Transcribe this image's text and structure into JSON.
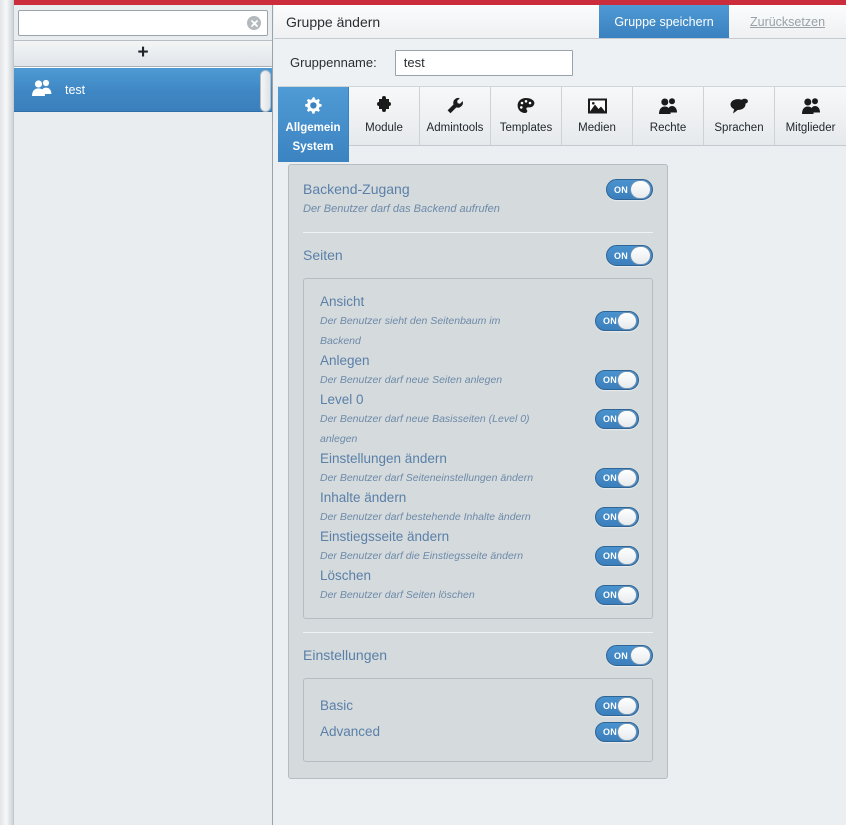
{
  "theme": {
    "accent": "#3c83c1",
    "red_bar": "#cc2d3c",
    "panel_bg": "#d5dadd",
    "title_color": "#5a80a8"
  },
  "sidebar": {
    "search": {
      "value": "",
      "placeholder": "",
      "clear_icon": "clear-circle-icon"
    },
    "add_button": {
      "label": "+",
      "icon": "plus-icon"
    },
    "items": [
      {
        "label": "test",
        "icon": "users-icon",
        "selected": true
      }
    ]
  },
  "header": {
    "title": "Gruppe ändern",
    "save_label": "Gruppe speichern",
    "reset_label": "Zurücksetzen"
  },
  "form": {
    "group_name_label": "Gruppenname:",
    "group_name_value": "test",
    "group_name_placeholder": ""
  },
  "tabs": [
    {
      "label": "Allgemein",
      "sublabel": "System",
      "icon": "gear-icon",
      "active": true
    },
    {
      "label": "Module",
      "sublabel": "",
      "icon": "puzzle-icon",
      "active": false
    },
    {
      "label": "Admintools",
      "sublabel": "",
      "icon": "wrench-icon",
      "active": false
    },
    {
      "label": "Templates",
      "sublabel": "",
      "icon": "palette-icon",
      "active": false
    },
    {
      "label": "Medien",
      "sublabel": "",
      "icon": "image-icon",
      "active": false
    },
    {
      "label": "Rechte",
      "sublabel": "",
      "icon": "user-icon",
      "active": false
    },
    {
      "label": "Sprachen",
      "sublabel": "",
      "icon": "speech-bubble-icon",
      "active": false
    },
    {
      "label": "Mitglieder",
      "sublabel": "",
      "icon": "user-icon",
      "active": false
    }
  ],
  "settings": {
    "backend_access": {
      "title": "Backend-Zugang",
      "desc": "Der Benutzer darf das Backend aufrufen",
      "toggle": "ON"
    },
    "pages": {
      "title": "Seiten",
      "toggle": "ON",
      "items": [
        {
          "title": "Ansicht",
          "desc": "Der Benutzer sieht den Seitenbaum im Backend",
          "toggle": "ON"
        },
        {
          "title": "Anlegen",
          "desc": "Der Benutzer darf neue Seiten anlegen",
          "toggle": "ON"
        },
        {
          "title": "Level 0",
          "desc": "Der Benutzer darf neue Basisseiten (Level 0) anlegen",
          "toggle": "ON"
        },
        {
          "title": "Einstellungen ändern",
          "desc": "Der Benutzer darf Seiteneinstellungen ändern",
          "toggle": "ON"
        },
        {
          "title": "Inhalte ändern",
          "desc": "Der Benutzer darf bestehende Inhalte ändern",
          "toggle": "ON"
        },
        {
          "title": "Einstiegsseite ändern",
          "desc": "Der Benutzer darf die Einstiegsseite ändern",
          "toggle": "ON"
        },
        {
          "title": "Löschen",
          "desc": "Der Benutzer darf Seiten löschen",
          "toggle": "ON"
        }
      ]
    },
    "configuration": {
      "title": "Einstellungen",
      "toggle": "ON",
      "items": [
        {
          "title": "Basic",
          "toggle": "ON"
        },
        {
          "title": "Advanced",
          "toggle": "ON"
        }
      ]
    }
  }
}
